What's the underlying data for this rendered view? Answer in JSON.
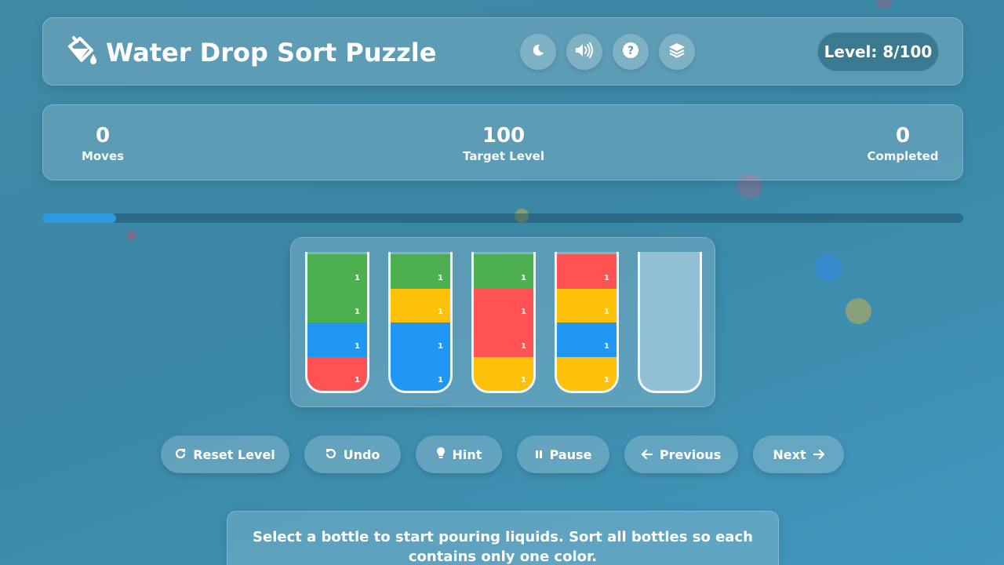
{
  "header": {
    "title": "Water Drop Sort Puzzle",
    "level_badge": "Level: 8/100",
    "icons": [
      "paint-bucket-icon",
      "moon-icon",
      "volume-icon",
      "help-icon",
      "layers-icon"
    ]
  },
  "stats": [
    {
      "value": "0",
      "label": "Moves"
    },
    {
      "value": "100",
      "label": "Target Level"
    },
    {
      "value": "0",
      "label": "Completed"
    }
  ],
  "progress": {
    "fraction": 0.08
  },
  "colors": {
    "green": "#4caf50",
    "blue": "#2196f3",
    "red": "#ff5252",
    "yellow": "#ffc107"
  },
  "bottles": [
    {
      "segments": [
        {
          "color": "green",
          "count": "1"
        },
        {
          "color": "green",
          "count": "1"
        },
        {
          "color": "blue",
          "count": "1"
        },
        {
          "color": "red",
          "count": "1"
        }
      ]
    },
    {
      "segments": [
        {
          "color": "green",
          "count": "1"
        },
        {
          "color": "yellow",
          "count": "1"
        },
        {
          "color": "blue",
          "count": "1"
        },
        {
          "color": "blue",
          "count": "1"
        }
      ]
    },
    {
      "segments": [
        {
          "color": "green",
          "count": "1"
        },
        {
          "color": "red",
          "count": "1"
        },
        {
          "color": "red",
          "count": "1"
        },
        {
          "color": "yellow",
          "count": "1"
        }
      ]
    },
    {
      "segments": [
        {
          "color": "red",
          "count": "1"
        },
        {
          "color": "yellow",
          "count": "1"
        },
        {
          "color": "blue",
          "count": "1"
        },
        {
          "color": "yellow",
          "count": "1"
        }
      ]
    },
    {
      "segments": []
    }
  ],
  "controls": {
    "reset": "Reset Level",
    "undo": "Undo",
    "hint": "Hint",
    "pause": "Pause",
    "previous": "Previous",
    "next": "Next"
  },
  "message": "Select a bottle to start pouring liquids. Sort all bottles so each contains only one color."
}
